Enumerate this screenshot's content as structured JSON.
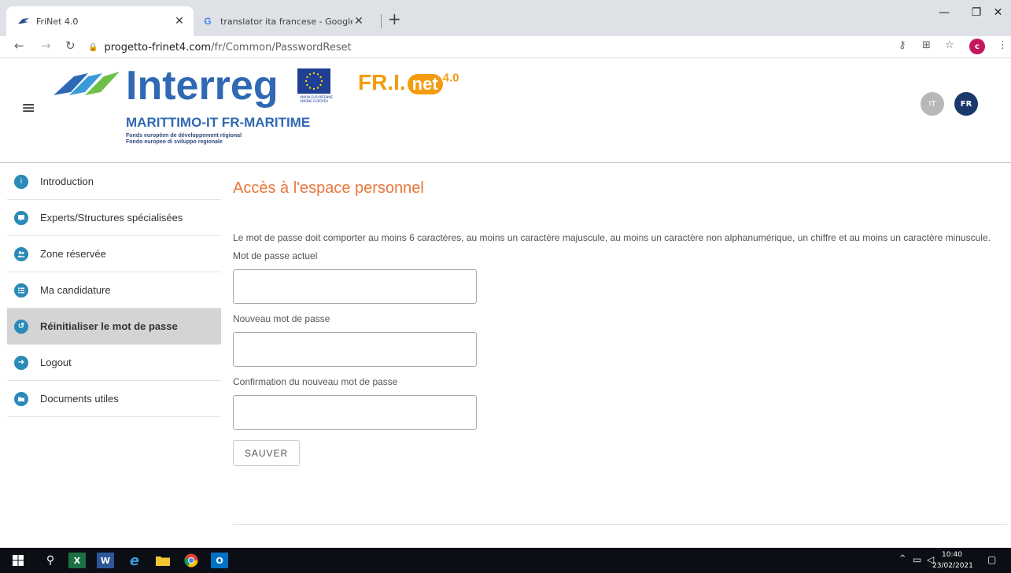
{
  "browser": {
    "tabs": [
      {
        "title": "FriNet 4.0",
        "active": true
      },
      {
        "title": "translator ita francese - Google S",
        "active": false
      }
    ],
    "url_host": "progetto-frinet4.com",
    "url_path": "/fr/Common/PasswordReset",
    "profile_initial": "c"
  },
  "header": {
    "brand": "Interreg",
    "program": "MARITTIMO-IT FR-MARITIME",
    "fund_line1": "Fonds européen de développement régional",
    "fund_line2": "Fondo europeo di sviluppo regionale",
    "eu_caption": "UNION EUROPÉENNE UNIONE EUROPEA",
    "frinet_prefix": "FR.I.",
    "frinet_net": "net",
    "frinet_version": "4.0",
    "lang_it": "IT",
    "lang_fr": "FR"
  },
  "sidebar": {
    "items": [
      {
        "label": "Introduction",
        "icon": "info-icon",
        "glyph": "i"
      },
      {
        "label": "Experts/Structures spécialisées",
        "icon": "chat-icon",
        "glyph": "💬"
      },
      {
        "label": "Zone réservée",
        "icon": "users-icon",
        "glyph": "👥"
      },
      {
        "label": "Ma candidature",
        "icon": "list-icon",
        "glyph": "☰"
      },
      {
        "label": "Réinitialiser le mot de passe",
        "icon": "reset-icon",
        "glyph": "↺",
        "active": true
      },
      {
        "label": "Logout",
        "icon": "logout-icon",
        "glyph": "➜"
      },
      {
        "label": "Documents utiles",
        "icon": "folder-icon",
        "glyph": "▬"
      }
    ]
  },
  "main": {
    "title": "Accès à l'espace personnel",
    "rules": "Le mot de passe doit comporter au moins 6 caractères, au moins un caractère majuscule, au moins un caractère non alphanumérique, un chiffre et au moins un caractère minuscule.",
    "current_label": "Mot de passe actuel",
    "new_label": "Nouveau mot de passe",
    "confirm_label": "Confirmation du nouveau mot de passe",
    "save_label": "SAUVER"
  },
  "taskbar": {
    "time": "10:40",
    "date": "23/02/2021"
  },
  "colors": {
    "accent_orange": "#e8773d",
    "brand_blue": "#2f69b3",
    "sidebar_icon": "#2a8ab8",
    "active_item_bg": "#d4d4d4"
  }
}
